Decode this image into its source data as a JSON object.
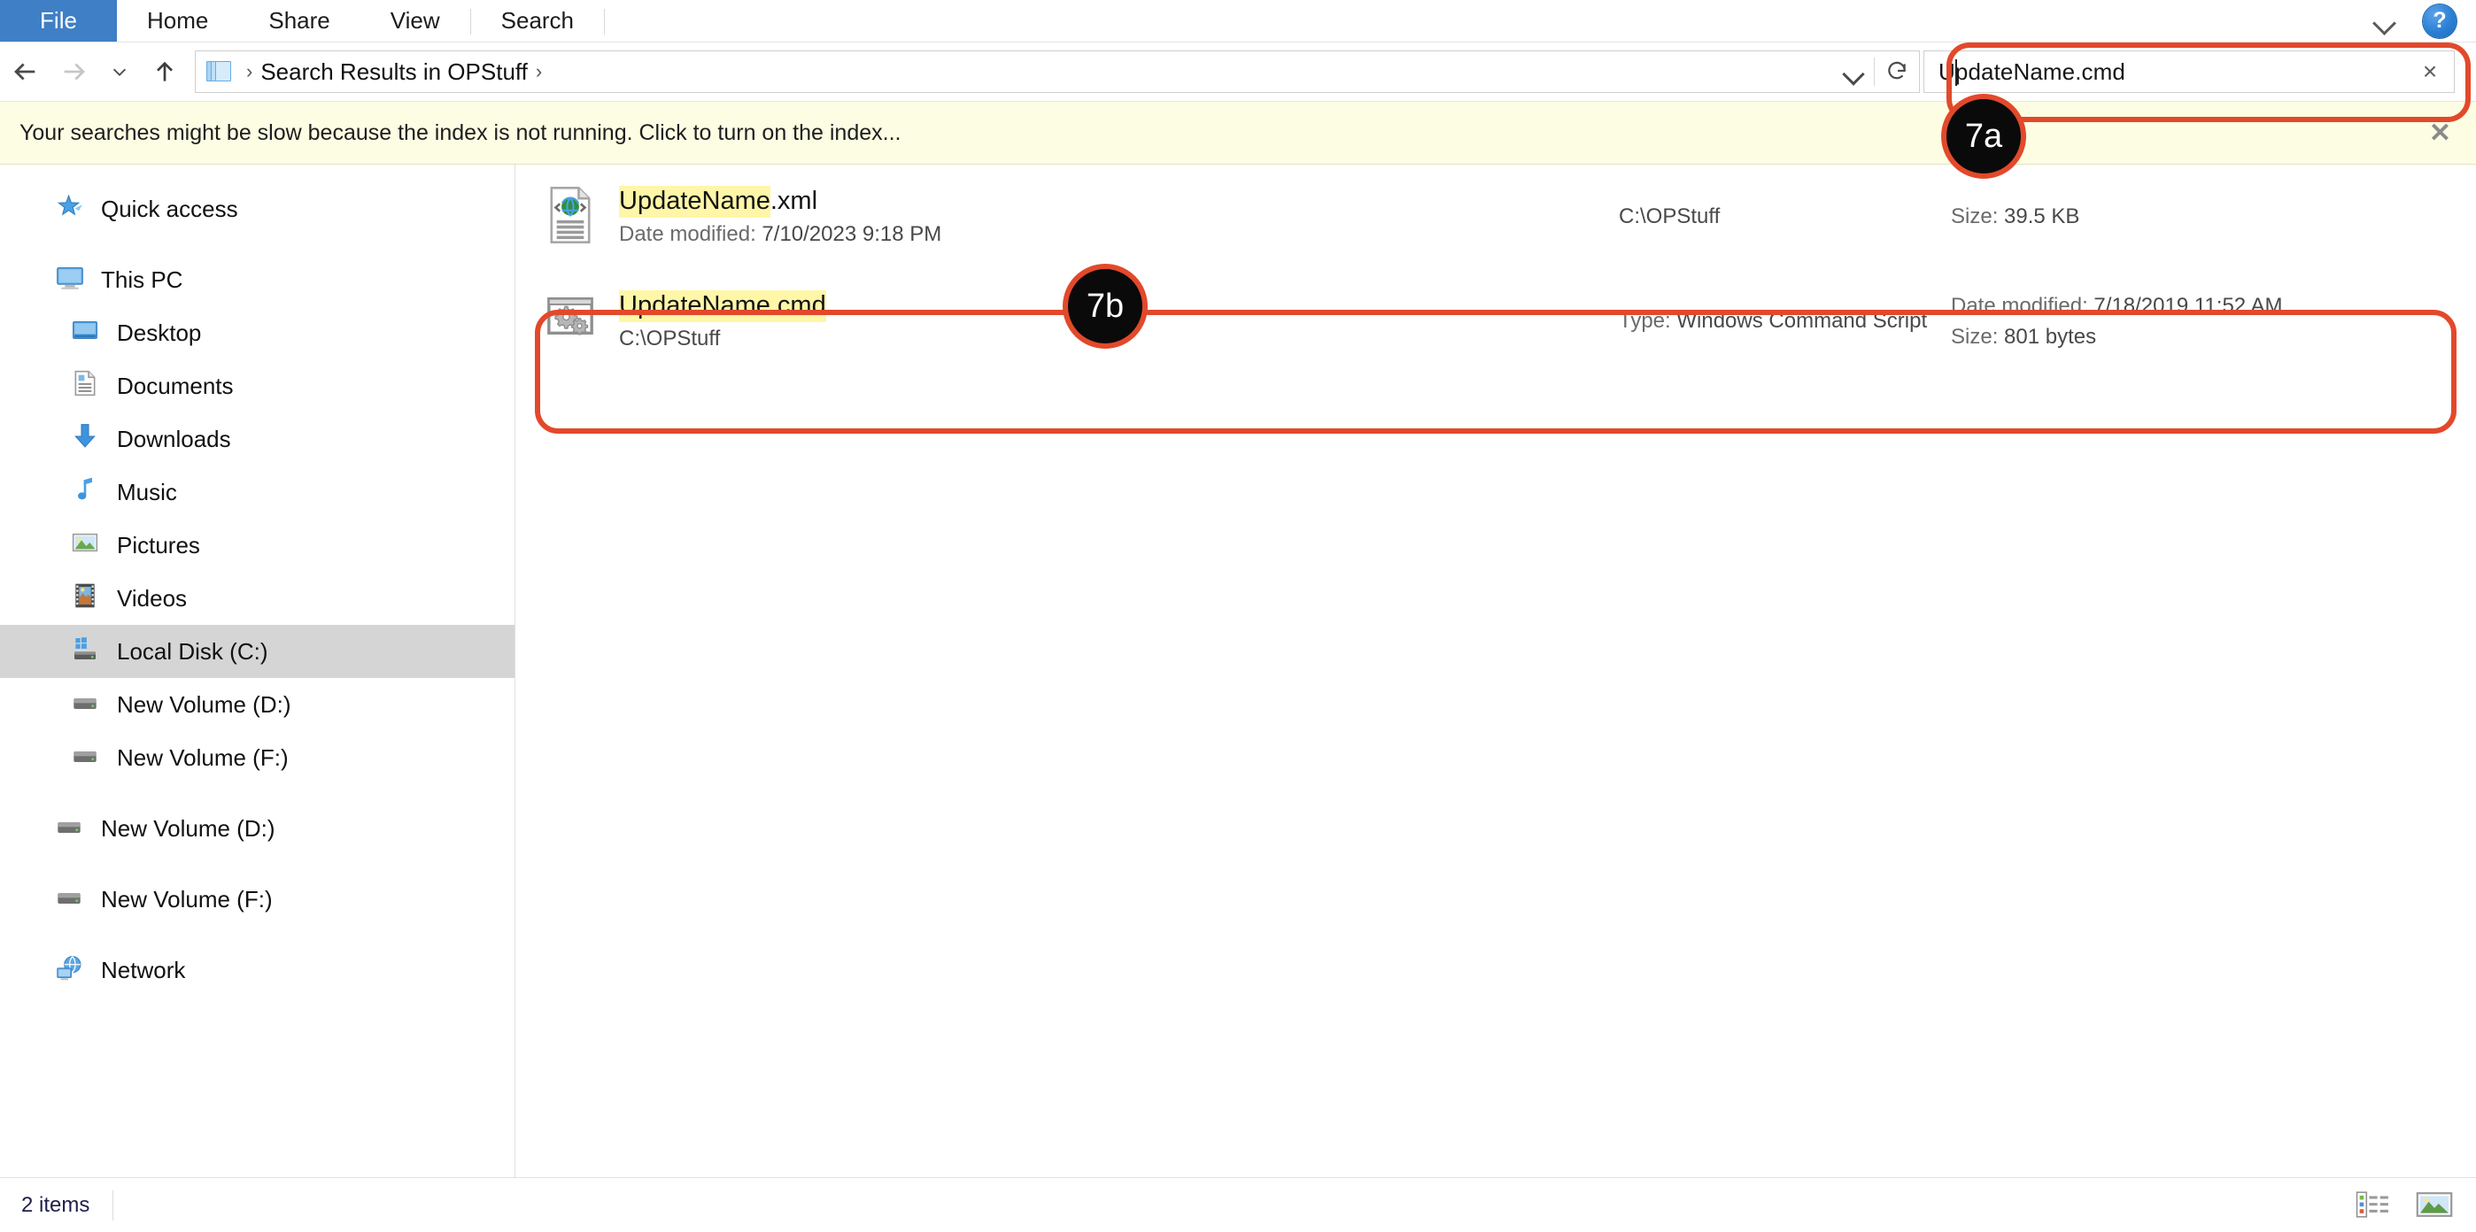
{
  "window": {
    "title": "Search Results in OPStuff"
  },
  "ribbon": {
    "file_tab": "File",
    "tabs": [
      "Home",
      "Share",
      "View",
      "Search"
    ],
    "collapse_icon": "chevron-down-icon",
    "help_label": "?"
  },
  "address_bar": {
    "back_icon": "arrow-left-icon",
    "forward_icon": "arrow-right-icon",
    "recent_icon": "chevron-down-icon",
    "up_icon": "arrow-up-icon",
    "folder_icon": "search-results-folder-icon",
    "separator": "›",
    "breadcrumb": "Search Results in OPStuff",
    "trailing_separator": "›",
    "dropdown_icon": "chevron-down-icon",
    "refresh_icon": "refresh-icon"
  },
  "search": {
    "value": "UpdateName.cmd",
    "value_head": "U",
    "value_tail": "pdateName.cmd",
    "clear_label": "×",
    "search_icon": "search-icon"
  },
  "notification": {
    "message": "Your searches might be slow because the index is not running.  Click to turn on the index...",
    "close_label": "✕"
  },
  "sidebar": {
    "items": [
      {
        "label": "Quick access",
        "icon": "star-pin-icon",
        "indent": false,
        "selected": false
      },
      {
        "label": "This PC",
        "icon": "monitor-icon",
        "indent": false,
        "selected": false
      },
      {
        "label": "Desktop",
        "icon": "desktop-icon",
        "indent": true,
        "selected": false
      },
      {
        "label": "Documents",
        "icon": "document-icon",
        "indent": true,
        "selected": false
      },
      {
        "label": "Downloads",
        "icon": "download-arrow-icon",
        "indent": true,
        "selected": false
      },
      {
        "label": "Music",
        "icon": "music-note-icon",
        "indent": true,
        "selected": false
      },
      {
        "label": "Pictures",
        "icon": "picture-icon",
        "indent": true,
        "selected": false
      },
      {
        "label": "Videos",
        "icon": "video-filmstrip-icon",
        "indent": true,
        "selected": false
      },
      {
        "label": "Local Disk (C:)",
        "icon": "windows-drive-icon",
        "indent": true,
        "selected": true
      },
      {
        "label": "New Volume (D:)",
        "icon": "drive-icon",
        "indent": true,
        "selected": false
      },
      {
        "label": "New Volume (F:)",
        "icon": "drive-icon",
        "indent": true,
        "selected": false
      },
      {
        "label": "New Volume (D:)",
        "icon": "drive-icon",
        "indent": false,
        "selected": false
      },
      {
        "label": "New Volume (F:)",
        "icon": "drive-icon",
        "indent": false,
        "selected": false
      },
      {
        "label": "Network",
        "icon": "network-icon",
        "indent": false,
        "selected": false
      }
    ]
  },
  "results": {
    "rows": [
      {
        "icon": "xml-file-icon",
        "name_highlight": "UpdateName",
        "name_rest": ".xml",
        "sub_label": "Date modified:",
        "sub_value": "7/10/2023 9:18 PM",
        "path": "C:\\OPStuff",
        "type_label": "",
        "type_value": "",
        "right_line1_label": "Size:",
        "right_line1_value": "39.5 KB",
        "right_line2_label": "",
        "right_line2_value": "",
        "highlighted": false
      },
      {
        "icon": "cmd-script-icon",
        "name_highlight": "UpdateName.cmd",
        "name_rest": "",
        "sub_label": "",
        "sub_value": "C:\\OPStuff",
        "path": "",
        "type_label": "Type:",
        "type_value": "Windows Command Script",
        "right_line1_label": "Date modified:",
        "right_line1_value": "7/18/2019 11:52 AM",
        "right_line2_label": "Size:",
        "right_line2_value": "801 bytes",
        "highlighted": true
      }
    ]
  },
  "status": {
    "item_count": "2 items",
    "details_view_icon": "details-view-icon",
    "large_icons_view_icon": "large-icons-view-icon"
  },
  "annotations": {
    "accent_color": "#e2492b",
    "bubble_bg": "#0a0a0a",
    "callouts": [
      {
        "label": "7a",
        "target": "search-box"
      },
      {
        "label": "7b",
        "target": "cmd-result-row"
      }
    ]
  },
  "colors": {
    "file_tab_blue": "#3f7fc5",
    "notification_bg": "#fdfde4",
    "highlight_yellow": "#fff6a8",
    "selection_gray": "#d5d5d5",
    "annotation_red": "#e2492b"
  }
}
